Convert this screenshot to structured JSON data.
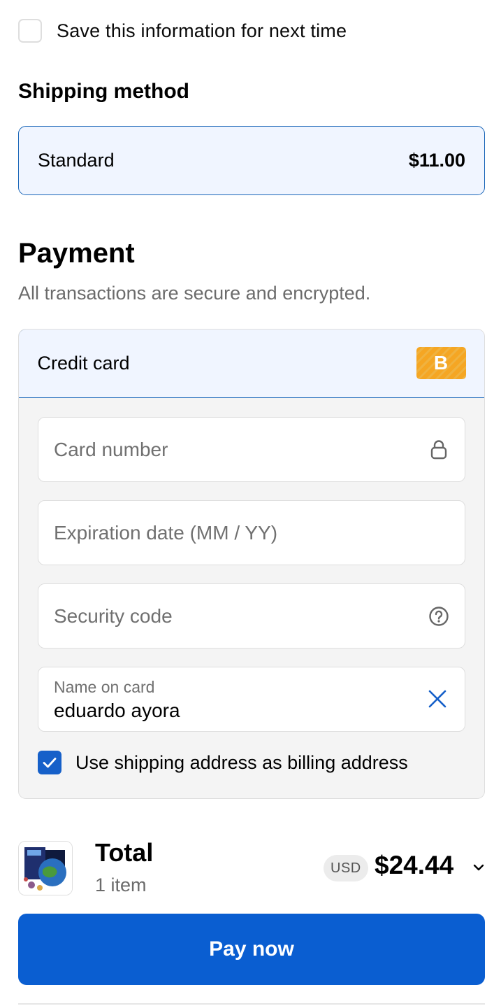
{
  "save_info": {
    "label": "Save this information for next time",
    "checked": false
  },
  "shipping": {
    "title": "Shipping method",
    "method_name": "Standard",
    "method_price": "$11.00"
  },
  "payment": {
    "title": "Payment",
    "subtitle": "All transactions are secure and encrypted.",
    "method_label": "Credit card",
    "method_badge": "B",
    "fields": {
      "card_number_placeholder": "Card number",
      "expiration_placeholder": "Expiration date (MM / YY)",
      "security_code_placeholder": "Security code",
      "name_label": "Name on card",
      "name_value": "eduardo ayora"
    },
    "billing_same_label": "Use shipping address as billing address",
    "billing_same_checked": true
  },
  "summary": {
    "total_label": "Total",
    "item_count": "1 item",
    "currency": "USD",
    "total_amount": "$24.44"
  },
  "actions": {
    "pay_label": "Pay now"
  },
  "colors": {
    "accent_blue": "#0a5ed1",
    "selected_border": "#1a66b8",
    "selected_bg": "#f0f5ff",
    "badge_orange": "#f5a623"
  },
  "icons": {
    "card_number": "lock-icon",
    "security_code": "help-circle-icon",
    "name_clear": "close-icon",
    "summary_toggle": "chevron-down-icon"
  }
}
